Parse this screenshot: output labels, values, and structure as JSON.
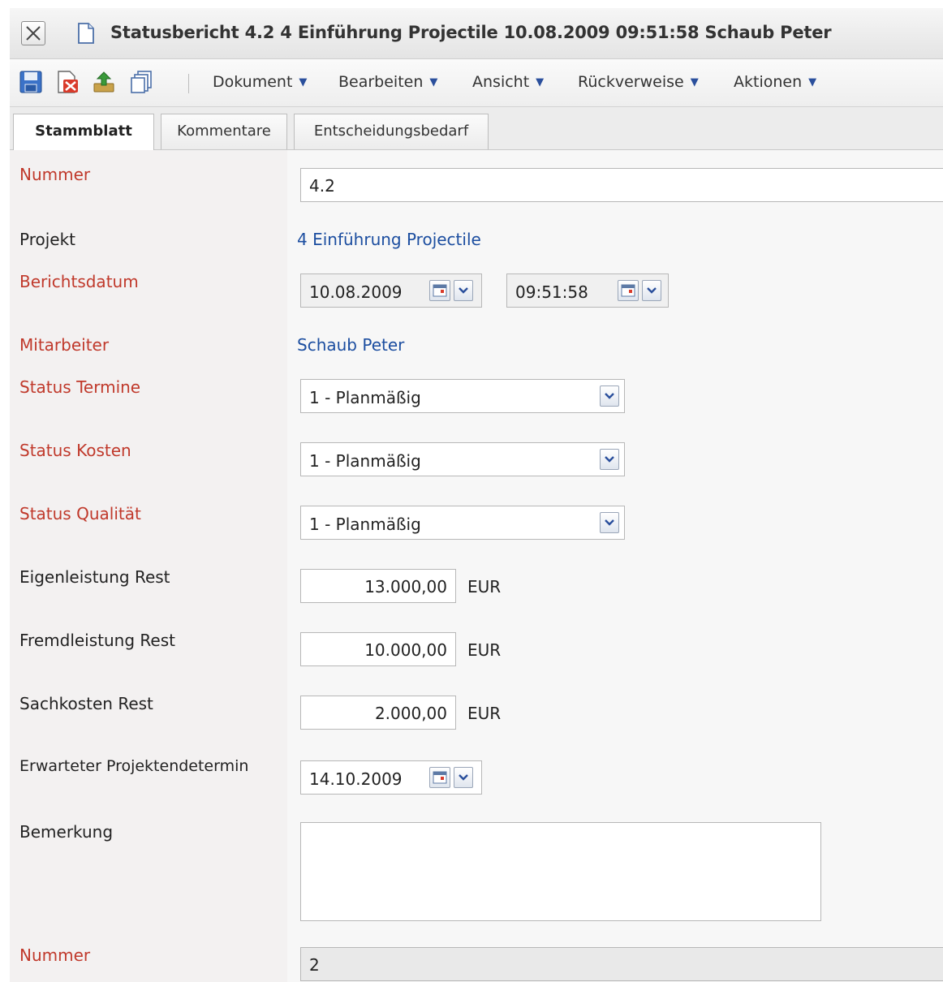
{
  "window": {
    "title": "Statusbericht 4.2 4 Einführung Projectile 10.08.2009 09:51:58 Schaub Peter"
  },
  "toolbar": {
    "icons": [
      "save-icon",
      "delete-document-icon",
      "upload-icon",
      "copy-icon"
    ],
    "menus": [
      "Dokument",
      "Bearbeiten",
      "Ansicht",
      "Rückverweise",
      "Aktionen"
    ]
  },
  "tabs": [
    {
      "label": "Stammblatt",
      "active": true
    },
    {
      "label": "Kommentare",
      "active": false
    },
    {
      "label": "Entscheidungsbedarf",
      "active": false
    }
  ],
  "form": {
    "nummer": {
      "label": "Nummer",
      "value": "4.2"
    },
    "projekt": {
      "label": "Projekt",
      "value": "4 Einführung Projectile"
    },
    "berichtsdatum": {
      "label": "Berichtsdatum",
      "date": "10.08.2009",
      "time": "09:51:58"
    },
    "mitarbeiter": {
      "label": "Mitarbeiter",
      "value": "Schaub Peter"
    },
    "status_termine": {
      "label": "Status Termine",
      "value": "1 - Planmäßig"
    },
    "status_kosten": {
      "label": "Status Kosten",
      "value": "1 - Planmäßig"
    },
    "status_qualitaet": {
      "label": "Status Qualität",
      "value": "1 - Planmäßig"
    },
    "eigenleistung": {
      "label": "Eigenleistung Rest",
      "value": "13.000,00",
      "unit": "EUR"
    },
    "fremdleistung": {
      "label": "Fremdleistung Rest",
      "value": "10.000,00",
      "unit": "EUR"
    },
    "sachkosten": {
      "label": "Sachkosten Rest",
      "value": "2.000,00",
      "unit": "EUR"
    },
    "projektendetermin": {
      "label": "Erwarteter Projektendetermin",
      "value": "14.10.2009"
    },
    "bemerkung": {
      "label": "Bemerkung",
      "value": ""
    },
    "nummer2": {
      "label": "Nummer",
      "value": "2"
    }
  },
  "colors": {
    "required_label": "#c0392b",
    "link": "#1c4ea0",
    "label_bg": "#f3f1f1"
  }
}
